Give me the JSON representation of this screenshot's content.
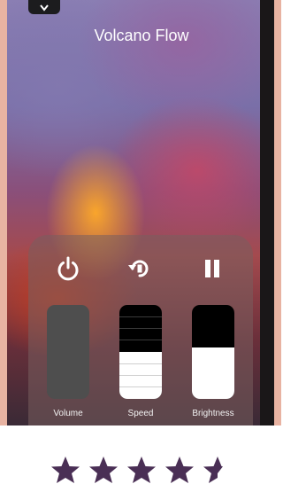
{
  "app": {
    "title": "Volcano Flow"
  },
  "controls": {
    "power": {
      "icon": "power-icon"
    },
    "loop": {
      "icon": "loop-icon"
    },
    "pause": {
      "icon": "pause-icon"
    }
  },
  "sliders": [
    {
      "id": "volume",
      "label": "Volume",
      "level": 0.0
    },
    {
      "id": "speed",
      "label": "Speed",
      "level": 0.5
    },
    {
      "id": "brightness",
      "label": "Brightness",
      "level": 0.55
    }
  ],
  "rating": {
    "value": 4.5,
    "max": 5,
    "star_color": "#4a2f55"
  },
  "colors": {
    "panel": "#7a5f5f",
    "text": "#ffffff"
  }
}
